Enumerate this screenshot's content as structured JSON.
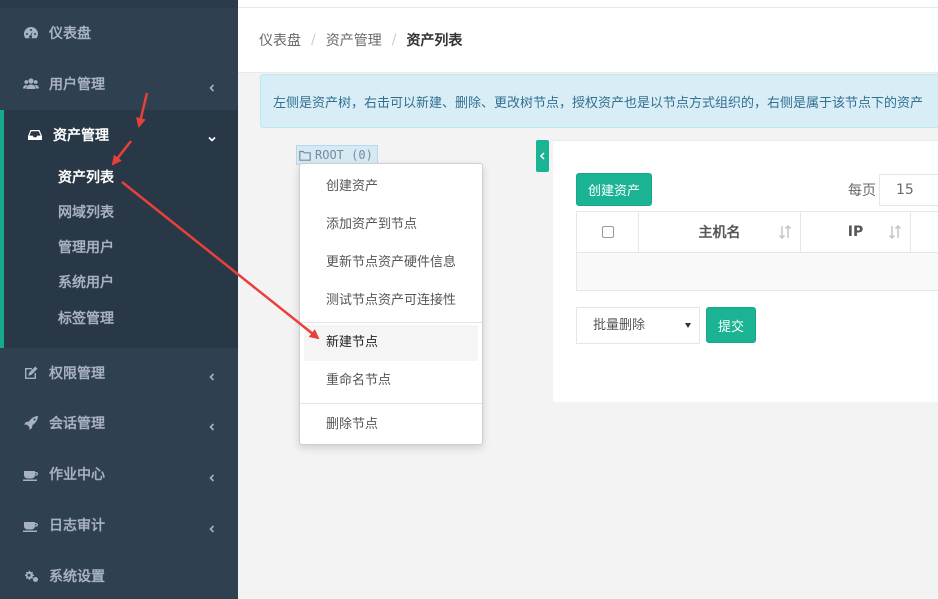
{
  "sidebar": {
    "items": [
      {
        "label": "仪表盘",
        "icon": "dashboard-icon"
      },
      {
        "label": "用户管理",
        "icon": "users-icon"
      },
      {
        "label": "资产管理",
        "icon": "inbox-icon"
      },
      {
        "label": "权限管理",
        "icon": "edit-icon"
      },
      {
        "label": "会话管理",
        "icon": "rocket-icon"
      },
      {
        "label": "作业中心",
        "icon": "coffee-icon"
      },
      {
        "label": "日志审计",
        "icon": "coffee-icon"
      },
      {
        "label": "系统设置",
        "icon": "cogs-icon"
      }
    ],
    "asset_sub_items": [
      "资产列表",
      "网域列表",
      "管理用户",
      "系统用户",
      "标签管理"
    ]
  },
  "breadcrumb": [
    "仪表盘",
    "资产管理",
    "资产列表"
  ],
  "breadcrumb_separator": "/",
  "info_text": "左侧是资产树，右击可以新建、删除、更改树节点，授权资产也是以节点方式组织的，右侧是属于该节点下的资产",
  "tree": {
    "root_label": "ROOT (0)"
  },
  "context_menu": [
    "创建资产",
    "添加资产到节点",
    "更新节点资产硬件信息",
    "测试节点资产可连接性",
    "新建节点",
    "重命名节点",
    "删除节点"
  ],
  "panel": {
    "create_button": "创建资产",
    "per_page_label": "每页",
    "per_page_value": "15",
    "columns": [
      "主机名",
      "IP"
    ],
    "bulk_select": "批量删除",
    "submit_button": "提交"
  },
  "colors": {
    "sidebar_bg": "#2f4050",
    "accent": "#1ab394",
    "info_bg": "#d9edf7",
    "annotation_arrow": "#e8403a"
  }
}
